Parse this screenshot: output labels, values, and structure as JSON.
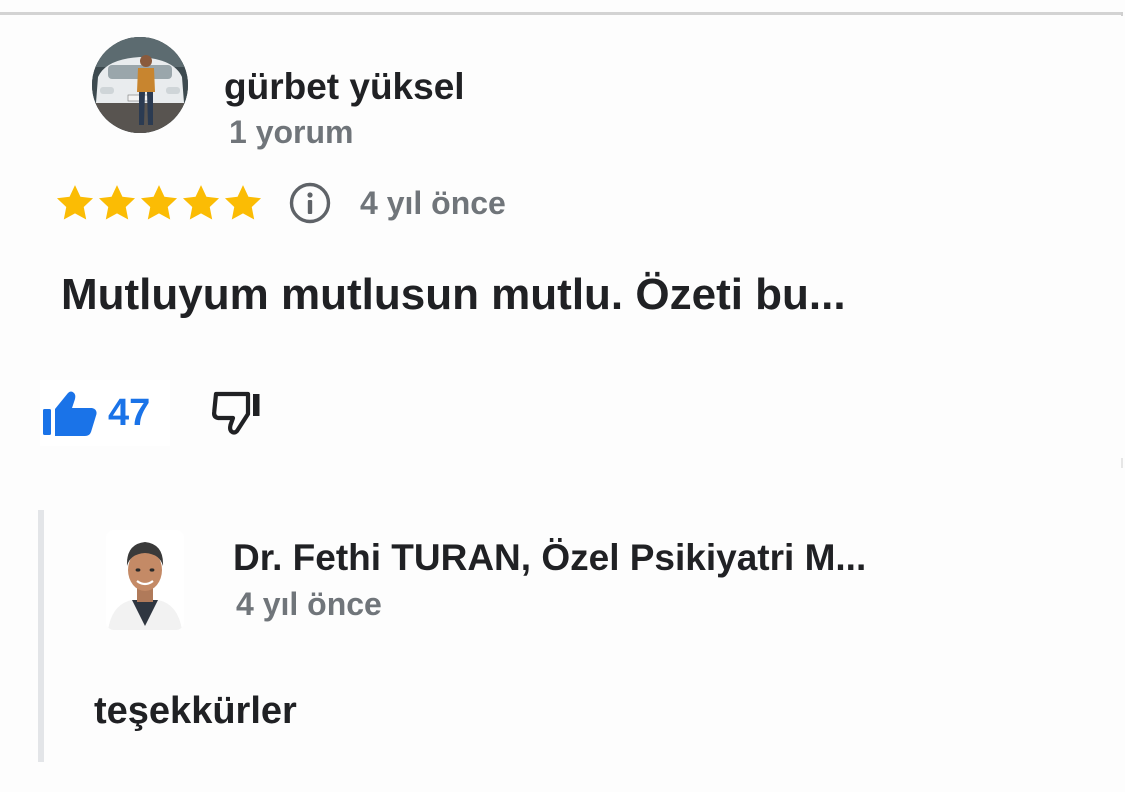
{
  "review": {
    "reviewer": {
      "name": "gürbet yüksel",
      "review_count": "1 yorum",
      "avatar": "reviewer-photo"
    },
    "rating": 5,
    "max_rating": 5,
    "info_icon": "info-icon",
    "time": "4 yıl önce",
    "text": "Mutluyum mutlusun mutlu. Özeti bu...",
    "like": {
      "icon": "thumb-up-icon",
      "count": "47"
    },
    "dislike": {
      "icon": "thumb-down-icon"
    }
  },
  "reply": {
    "owner_name": "Dr. Fethi TURAN, Özel Psikiyatri M...",
    "time": "4 yıl önce",
    "text": "teşekkürler",
    "avatar": "owner-photo"
  },
  "colors": {
    "star": "#fbbc04",
    "like_blue": "#1a73e8",
    "secondary_text": "#70757a",
    "primary_text": "#202124",
    "reply_bar": "#e3e5e8"
  }
}
